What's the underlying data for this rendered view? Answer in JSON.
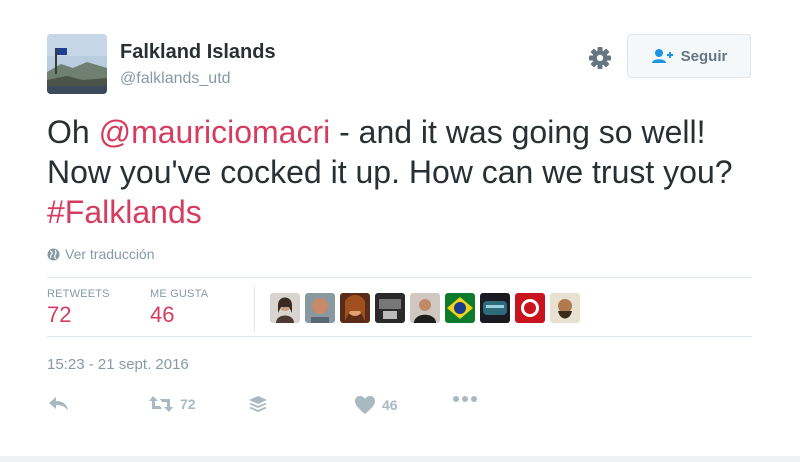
{
  "profile": {
    "display_name": "Falkland Islands",
    "username": "@falklands_utd"
  },
  "follow_button": {
    "label": "Seguir"
  },
  "tweet": {
    "text_parts": [
      {
        "type": "text",
        "value": "Oh "
      },
      {
        "type": "mention",
        "value": "@mauriciomacri"
      },
      {
        "type": "text",
        "value": " - and it was going so well! Now you've cocked it up. How can we trust you? "
      },
      {
        "type": "hashtag",
        "value": "#Falklands"
      }
    ]
  },
  "translate": {
    "label": "Ver traducción"
  },
  "stats": {
    "retweets_label": "RETWEETS",
    "retweets_value": "72",
    "likes_label": "ME GUSTA",
    "likes_value": "46"
  },
  "likers_count_shown": 9,
  "timestamp": "15:23 - 21 sept. 2016",
  "actions": {
    "reply_icon": "reply-icon",
    "retweet_icon": "retweet-icon",
    "retweet_count": "72",
    "buffer_icon": "layers-icon",
    "like_icon": "heart-icon",
    "like_count": "46",
    "more_icon": "more-icon"
  },
  "colors": {
    "accent": "#d63c5f",
    "text": "#292f33",
    "muted": "#8899a6"
  }
}
